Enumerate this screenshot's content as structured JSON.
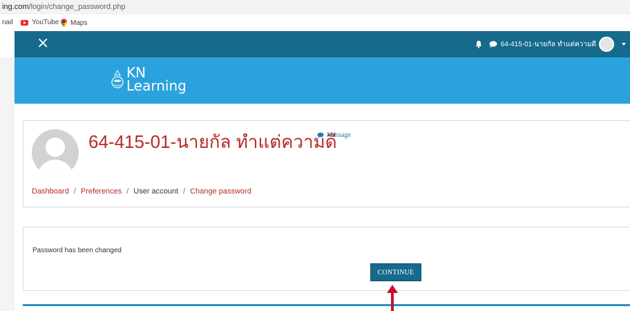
{
  "browser": {
    "url_domain": "ing.com",
    "url_path": "/login/change_password.php",
    "bookmarks": [
      {
        "label": "nail",
        "icon": "none"
      },
      {
        "label": "YouTube",
        "icon": "youtube-icon"
      },
      {
        "label": "Maps",
        "icon": "maps-icon"
      }
    ]
  },
  "navbar": {
    "close_icon": "×",
    "user_name": "64-415-01-นายกัล ทำแต่ความดี",
    "colors": {
      "bg": "#166a8b",
      "text": "#ffffff"
    }
  },
  "banner": {
    "logo_line1": "KN",
    "logo_line2": "Learning",
    "color": "#2aa2dd"
  },
  "header": {
    "title": "64-415-01-นายกัล ทำแต่ความดี",
    "message_label": "Message",
    "breadcrumb": [
      "Dashboard",
      "Preferences",
      "User account",
      "Change password"
    ],
    "breadcrumb_separator": "/"
  },
  "notice": {
    "text": "Password has been changed",
    "continue_label": "CONTINUE"
  },
  "accent_red": "#b52b27",
  "annotation_color": "#c8102e"
}
